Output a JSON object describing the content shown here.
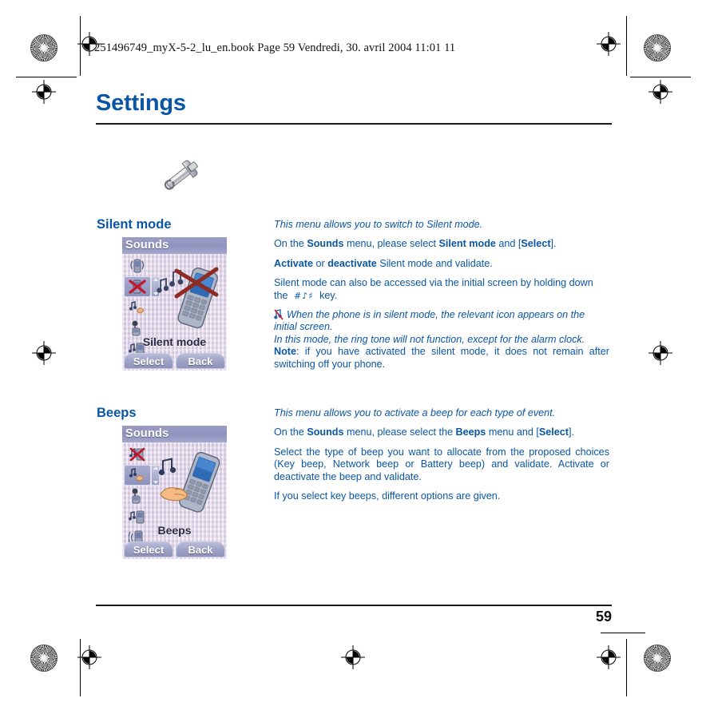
{
  "print_header": {
    "filename_line": "251496749_myX-5-2_lu_en.book  Page 59  Vendredi, 30. avril 2004  11:01 11"
  },
  "chapter": {
    "title": "Settings",
    "icon": "wrench-icon"
  },
  "colors": {
    "accent_blue": "#0b56a4",
    "rule_black": "#1a1a1a",
    "phone_titlebar": "#8f93bd",
    "phone_background": "#d7cde0"
  },
  "sections": [
    {
      "id": "silent-mode",
      "heading": "Silent mode",
      "screenshot": {
        "title": "Sounds",
        "label": "Silent mode",
        "softkeys": [
          "Select",
          "Back"
        ],
        "icons": [
          "ring-tone-icon",
          "silent-mode-icon",
          "beeps-icon",
          "voice-recorder-icon",
          "melody-icon"
        ],
        "selected_icon_index": 1
      },
      "intro": "This menu allows you to switch to Silent mode.",
      "paragraphs": [
        {
          "parts": [
            {
              "t": "On the ",
              "s": "n"
            },
            {
              "t": "Sounds",
              "s": "b"
            },
            {
              "t": " menu, please select ",
              "s": "n"
            },
            {
              "t": "Silent mode",
              "s": "b"
            },
            {
              "t": " and [",
              "s": "n"
            },
            {
              "t": "Select",
              "s": "b"
            },
            {
              "t": "].",
              "s": "n"
            }
          ]
        },
        {
          "parts": [
            {
              "t": "Activate",
              "s": "b"
            },
            {
              "t": " or ",
              "s": "n"
            },
            {
              "t": "deactivate",
              "s": "b"
            },
            {
              "t": " Silent mode and validate.",
              "s": "n"
            }
          ]
        },
        {
          "parts": [
            {
              "t": "Silent mode can also be accessed via the initial screen by holding down the ",
              "s": "n"
            },
            {
              "t": "#",
              "s": "key"
            },
            {
              "t": " key.",
              "s": "n"
            }
          ]
        },
        {
          "parts": [
            {
              "t": "",
              "s": "noteicon"
            },
            {
              "t": "When the phone is in silent mode, the relevant icon appears on the initial screen.",
              "s": "i"
            }
          ]
        },
        {
          "parts": [
            {
              "t": "In this mode, the ring tone will not function, except for the alarm clock.",
              "s": "i"
            }
          ]
        },
        {
          "parts": [
            {
              "t": "Note",
              "s": "b"
            },
            {
              "t": ": if you have activated the silent mode, it does not remain after switching off your phone.",
              "s": "n"
            }
          ]
        }
      ]
    },
    {
      "id": "beeps",
      "heading": "Beeps",
      "screenshot": {
        "title": "Sounds",
        "label": "Beeps",
        "softkeys": [
          "Select",
          "Back"
        ],
        "icons": [
          "silent-mode-icon",
          "beeps-icon",
          "voice-recorder-icon",
          "melody-icon",
          "vibrate-icon"
        ],
        "selected_icon_index": 1
      },
      "intro": "This menu allows you to activate a beep for each type of event.",
      "paragraphs": [
        {
          "parts": [
            {
              "t": "On the ",
              "s": "n"
            },
            {
              "t": "Sounds",
              "s": "b"
            },
            {
              "t": " menu, please select the ",
              "s": "n"
            },
            {
              "t": "Beeps",
              "s": "b"
            },
            {
              "t": " menu and [",
              "s": "n"
            },
            {
              "t": "Select",
              "s": "b"
            },
            {
              "t": "].",
              "s": "n"
            }
          ]
        },
        {
          "parts": [
            {
              "t": "Select the type of beep you want to allocate from the proposed choices (Key beep, Network beep or Battery beep) and validate. Activate or deactivate the beep and validate.",
              "s": "n"
            }
          ]
        },
        {
          "parts": [
            {
              "t": "If you select key beeps, different options are given.",
              "s": "n"
            }
          ]
        }
      ]
    }
  ],
  "footer": {
    "page_number": "59"
  }
}
